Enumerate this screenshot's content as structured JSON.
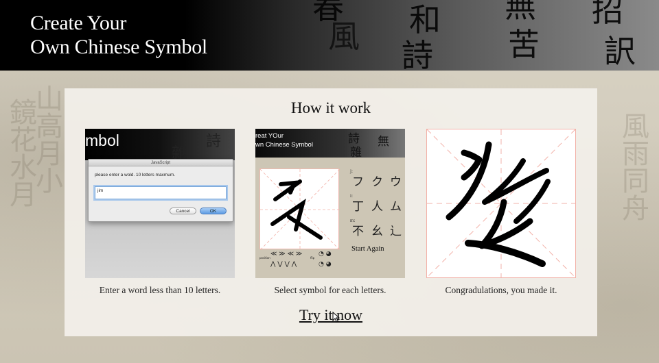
{
  "header": {
    "title_line1": "Create Your",
    "title_line2": "Own Chinese Symbol"
  },
  "how_it_works": {
    "title": "How it work",
    "steps": [
      {
        "caption": "Enter a word less than 10 letters.",
        "screenshot": {
          "banner_text": "mbol",
          "dialog_title": "JavaScript",
          "dialog_message": "please enter a wold. 10 letters maxmum.",
          "input_value": "jim",
          "cancel_label": "Cancel",
          "ok_label": "OK"
        }
      },
      {
        "caption": "Select symbol for each letters.",
        "screenshot": {
          "banner_line1": "reat YOur",
          "banner_line2": "wn Chinese Symbol",
          "letter_labels": [
            "j:",
            "i:",
            "m:"
          ],
          "start_again_label": "Start Again",
          "toolbar_label_left": "position",
          "toolbar_label_right": "flip"
        }
      },
      {
        "caption": "Congradulations, you made it."
      }
    ],
    "cta_label": "Try it now"
  },
  "colors": {
    "header_bg": "#000000",
    "panel_bg": "#f3f0eb",
    "grid_line": "#f2b1a8",
    "dialog_ok": "#5d9be3"
  }
}
